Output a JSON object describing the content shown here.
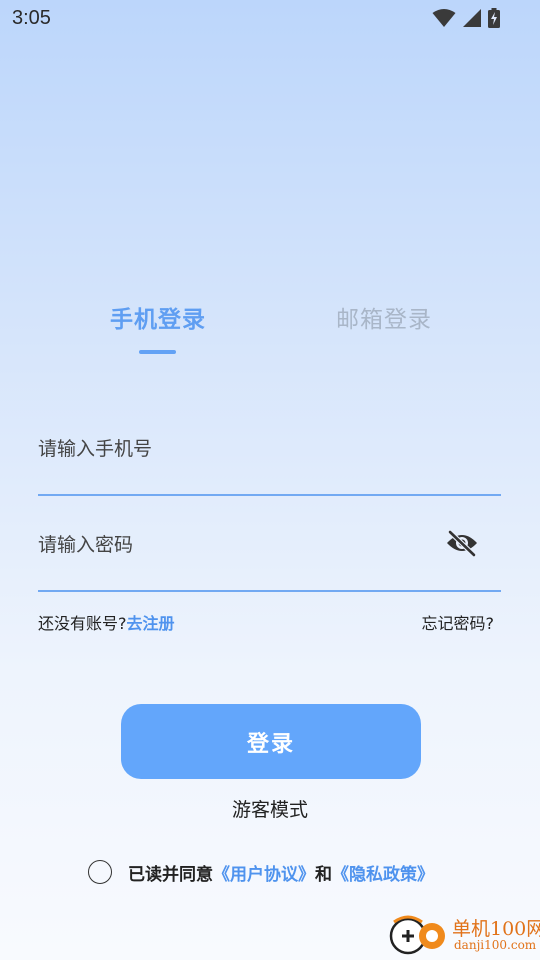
{
  "status_bar": {
    "time": "3:05",
    "icons": [
      "wifi-icon",
      "signal-icon",
      "battery-charging-icon"
    ]
  },
  "tabs": [
    {
      "label": "手机登录",
      "active": true
    },
    {
      "label": "邮箱登录",
      "active": false
    }
  ],
  "phone_input": {
    "value": "",
    "placeholder": "请输入手机号"
  },
  "password_input": {
    "value": "",
    "placeholder": "请输入密码",
    "visibility_icon": "eye-off-icon"
  },
  "register": {
    "prompt": "还没有账号?",
    "link": "去注册"
  },
  "forgot_password": "忘记密码?",
  "login_button": "登录",
  "guest_mode": "游客模式",
  "agreement": {
    "prefix": "已读并同意",
    "user_agreement": "《用户协议》",
    "and": "和",
    "privacy_policy": "《隐私政策》"
  },
  "watermark": {
    "title": "单机100网",
    "subtitle": "danji100.com"
  },
  "colors": {
    "accent": "#63a6fb",
    "link": "#4f93ee",
    "inactive_tab": "#a9b6c8",
    "watermark": "#e1731a"
  }
}
